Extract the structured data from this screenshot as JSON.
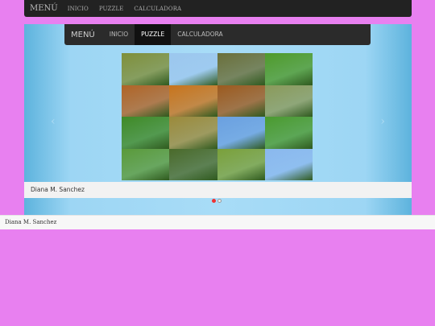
{
  "navbar": {
    "brand": "MENÚ",
    "links": [
      "INICIO",
      "PUZZLE",
      "CALCULADORA"
    ]
  },
  "slider": {
    "inner_nav": {
      "brand": "MENÚ",
      "links": [
        "INICIO",
        "PUZZLE",
        "CALCULADORA"
      ],
      "active": "PUZZLE"
    },
    "caption": "Diana M. Sanchez",
    "dots": [
      true,
      false
    ]
  },
  "footer": {
    "text": "Diana M. Sanchez"
  },
  "tiles": [
    "#7f8f3a",
    "#9cc7ee",
    "#6a6f3a",
    "#4e9a2a",
    "#b06426",
    "#c8741c",
    "#9c5a1e",
    "#8a9a5a",
    "#3f8a26",
    "#9b8a3a",
    "#6aa0e0",
    "#4a9a2e",
    "#5a9a3a",
    "#4a6a2a",
    "#7aa03a",
    "#8ab8ee"
  ]
}
